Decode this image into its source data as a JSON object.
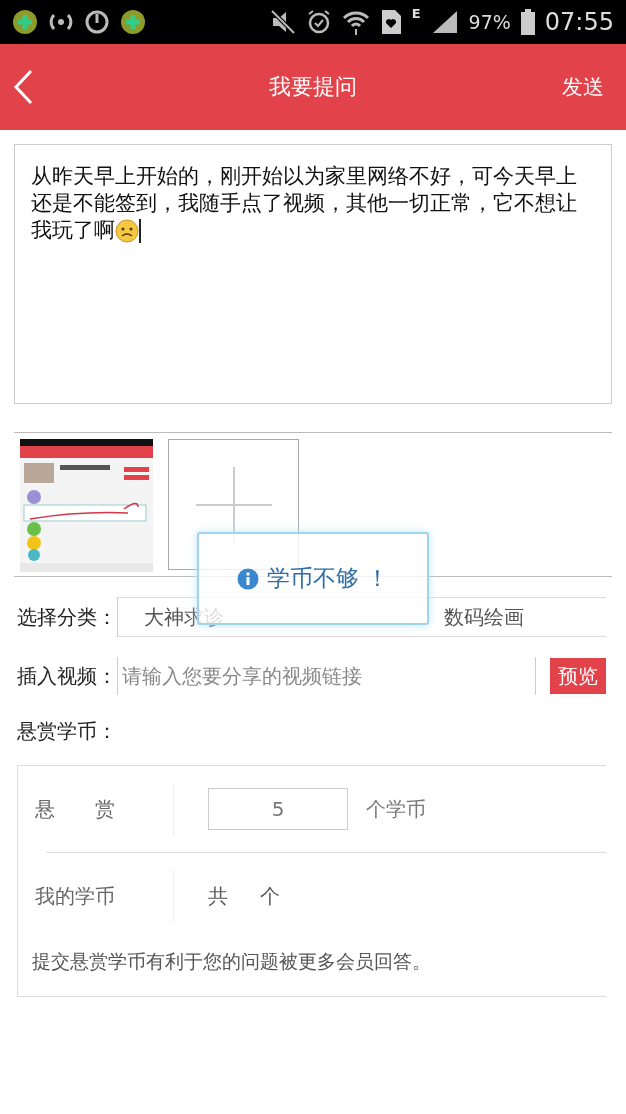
{
  "status_bar": {
    "network": "E",
    "battery": "97%",
    "time": "07:55"
  },
  "header": {
    "title": "我要提问",
    "send": "发送"
  },
  "question": {
    "value": "从昨天早上开始的，刚开始以为家里网络不好，可今天早上还是不能签到，我随手点了视频，其他一切正常，它不想让我玩了啊"
  },
  "attachments": [
    {
      "kind": "picture"
    },
    {
      "kind": "add"
    }
  ],
  "toast": {
    "message": "学币不够 ！"
  },
  "category": {
    "label": "选择分类：",
    "options": [
      "大神求诊",
      "数码绘画"
    ]
  },
  "video": {
    "label": "插入视频：",
    "placeholder": "请输入您要分享的视频链接",
    "button": "预览"
  },
  "reward": {
    "label": "悬赏学币：",
    "reward_label": "悬　　赏",
    "amount": "5",
    "unit": "个学币",
    "mine_label": "我的学币",
    "total_prefix": "共",
    "total_suffix": "个",
    "hint": "提交悬赏学币有利于您的问题被更多会员回答。"
  }
}
